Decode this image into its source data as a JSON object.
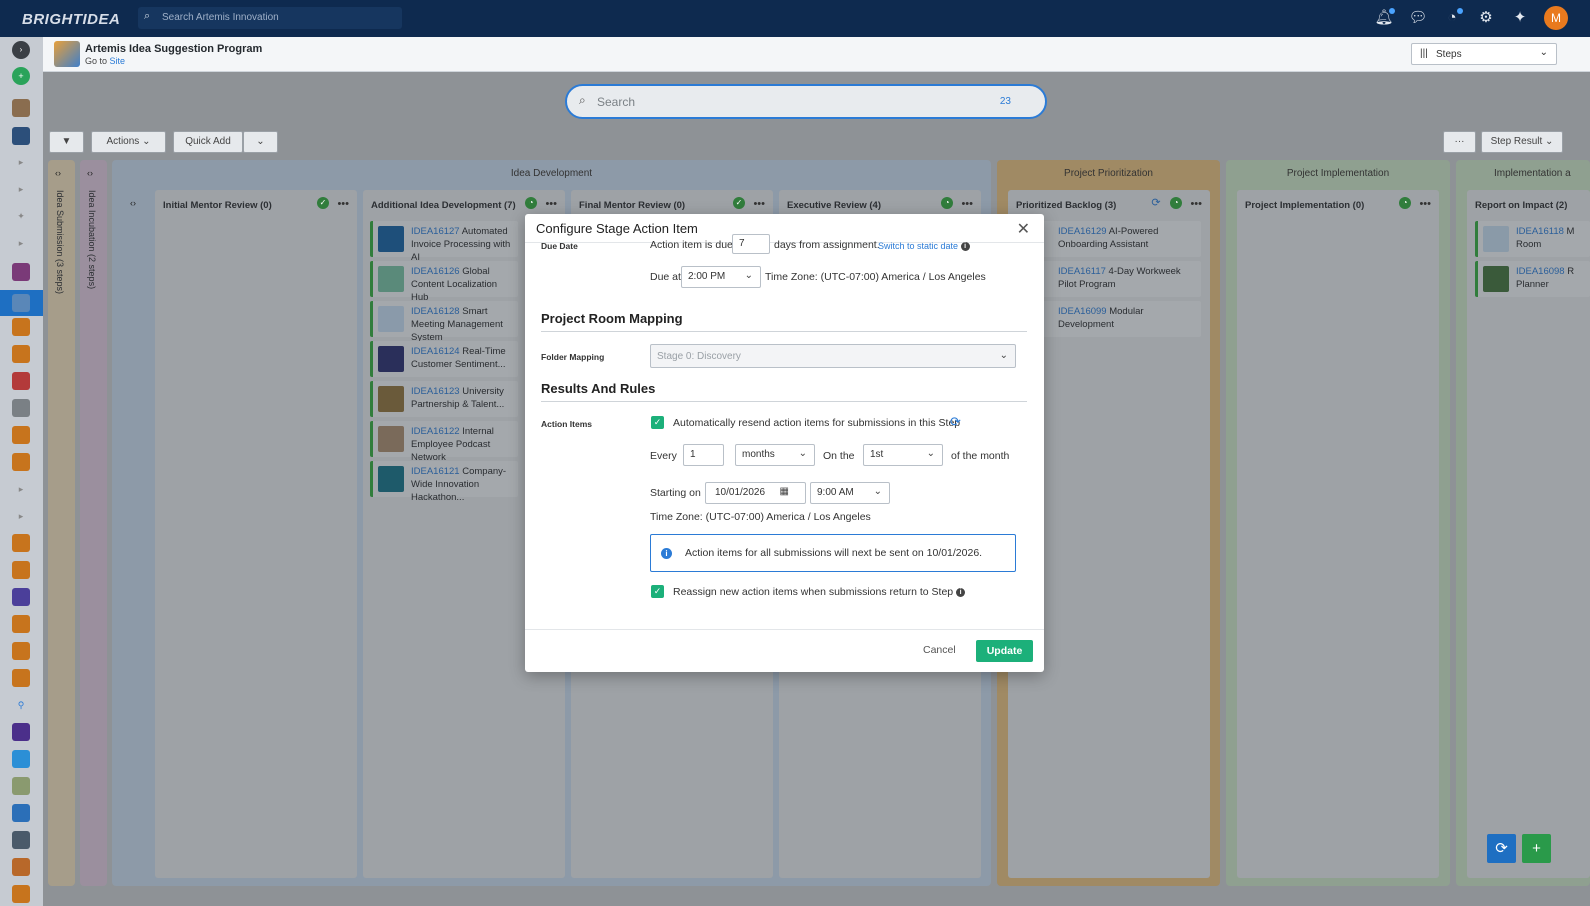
{
  "app": {
    "logo": "BRIGHTIDEA",
    "search_placeholder": "Search Artemis Innovation",
    "avatar_initial": "M"
  },
  "header": {
    "program_title": "Artemis Idea Suggestion Program",
    "goto_prefix": "Go to",
    "goto_link": "Site",
    "view_select": "Steps"
  },
  "board": {
    "search_placeholder": "Search",
    "search_count": "23",
    "actions_label": "Actions",
    "quick_add_label": "Quick Add",
    "more_label": "···",
    "step_result_label": "Step Result",
    "collapsed_lanes": [
      "Idea Submission (3 steps)",
      "Idea Incubation (2 steps)"
    ],
    "groups": [
      "Idea Development",
      "Project Prioritization",
      "Project Implementation",
      "Implementation a"
    ],
    "lanes": [
      {
        "title": "Initial Mentor Review (0)",
        "cards": []
      },
      {
        "title": "Additional Idea Development (7)",
        "cards": [
          {
            "id": "IDEA16127",
            "name": "Automated Invoice Processing with AI"
          },
          {
            "id": "IDEA16126",
            "name": "Global Content Localization Hub"
          },
          {
            "id": "IDEA16128",
            "name": "Smart Meeting Management System"
          },
          {
            "id": "IDEA16124",
            "name": "Real-Time Customer Sentiment..."
          },
          {
            "id": "IDEA16123",
            "name": "University Partnership & Talent..."
          },
          {
            "id": "IDEA16122",
            "name": "Internal Employee Podcast Network"
          },
          {
            "id": "IDEA16121",
            "name": "Company-Wide Innovation Hackathon..."
          }
        ]
      },
      {
        "title": "Final Mentor Review (0)",
        "cards": []
      },
      {
        "title": "Executive Review (4)",
        "cards": []
      },
      {
        "title": "Prioritized Backlog (3)",
        "cards": [
          {
            "id": "IDEA16129",
            "name": "AI-Powered Onboarding Assistant"
          },
          {
            "id": "IDEA16117",
            "name": "4-Day Workweek Pilot Program"
          },
          {
            "id": "IDEA16099",
            "name": "Modular Development"
          }
        ]
      },
      {
        "title": "Project Implementation (0)",
        "cards": []
      },
      {
        "title": "Report on Impact (2)",
        "cards": [
          {
            "id": "IDEA16118",
            "name": "Room"
          },
          {
            "id": "IDEA16098",
            "name": "Planner"
          }
        ]
      }
    ],
    "report_extra": [
      "M",
      "R"
    ]
  },
  "modal": {
    "title": "Configure Stage Action Item",
    "due_date_label": "Due Date",
    "due_prefix": "Action item is due",
    "due_days": "7",
    "due_suffix": "days from assignment.",
    "switch_link": "Switch to static date",
    "due_at_label": "Due at",
    "due_at_value": "2:00 PM",
    "timezone_text": "Time Zone: (UTC-07:00) America / Los Angeles",
    "section_room": "Project Room Mapping",
    "folder_label": "Folder Mapping",
    "folder_value": "Stage 0: Discovery",
    "section_results": "Results And Rules",
    "action_items_label": "Action Items",
    "resend_text": "Automatically resend action items for submissions in this Step",
    "every_label": "Every",
    "every_value": "1",
    "period_value": "months",
    "on_the_label": "On the",
    "day_value": "1st",
    "of_month_label": "of the month",
    "starting_label": "Starting on",
    "start_date": "10/01/2026",
    "start_time": "9:00 AM",
    "timezone_text_2": "Time Zone: (UTC-07:00) America / Los Angeles",
    "info_text": "Action items for all submissions will next be sent on 10/01/2026.",
    "reassign_text": "Reassign new action items when submissions return to Step",
    "cancel_label": "Cancel",
    "update_label": "Update"
  }
}
